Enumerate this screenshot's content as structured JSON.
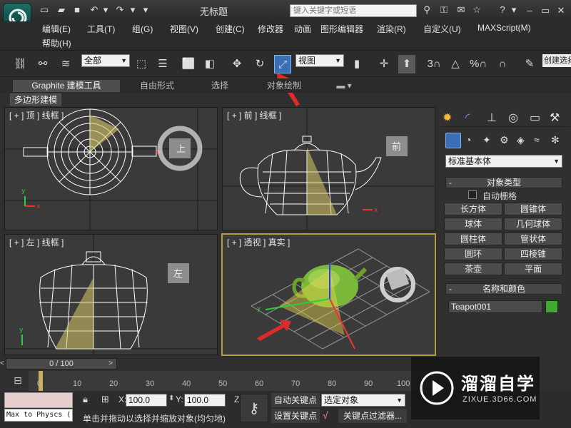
{
  "window": {
    "title": "无标题"
  },
  "search": {
    "placeholder": "键入关键字或短语"
  },
  "menu": [
    "编辑(E)",
    "工具(T)",
    "组(G)",
    "视图(V)",
    "创建(C)",
    "修改器",
    "动画",
    "图形编辑器",
    "渲染(R)",
    "自定义(U)",
    "MAXScript(M)",
    "帮助(H)"
  ],
  "toolbar": {
    "selection_filter": "全部",
    "ref_coord": "视图",
    "snap_label": "3",
    "angle_label": "△",
    "percent_label": "%",
    "create_sel_set": "创建选择"
  },
  "ribbon": {
    "tabs": [
      "Graphite 建模工具",
      "自由形式",
      "选择",
      "对象绘制"
    ],
    "subtab": "多边形建模"
  },
  "viewports": {
    "top": "[ + ] 顶 ] 线框 ]",
    "front": "[ + ] 前 ] 线框 ]",
    "left": "[ + ] 左 ] 线框 ]",
    "persp": "[ + ] 透视 ] 真实 ]",
    "viewcube_top": "上",
    "viewcube_front": "前",
    "viewcube_left": "左"
  },
  "command_panel": {
    "category": "标准基本体",
    "object_type_title": "对象类型",
    "autogrid": "自动栅格",
    "buttons": [
      "长方体",
      "圆锥体",
      "球体",
      "几何球体",
      "圆柱体",
      "管状体",
      "圆环",
      "四棱锥",
      "茶壶",
      "平面"
    ],
    "name_color_title": "名称和颜色",
    "object_name": "Teapot001",
    "object_color": "#3faa2f"
  },
  "timeline": {
    "slider": "0 / 100",
    "ticks": [
      "0",
      "10",
      "20",
      "30",
      "40",
      "50",
      "60",
      "70",
      "80",
      "90",
      "100"
    ]
  },
  "status": {
    "script_listener": "Max to Physcs (",
    "prompt": "单击并拖动以选择并缩放对象(均匀地)",
    "x_label": "X:",
    "x_value": "100.0",
    "y_label": "Y:",
    "y_value": "100.0",
    "z_label": "Z",
    "auto_key": "自动关键点",
    "set_key": "设置关键点",
    "selected": "选定对象",
    "key_filters": "关键点过滤器..."
  },
  "watermark": {
    "title": "溜溜自学",
    "url": "ZIXUE.3D66.COM"
  }
}
